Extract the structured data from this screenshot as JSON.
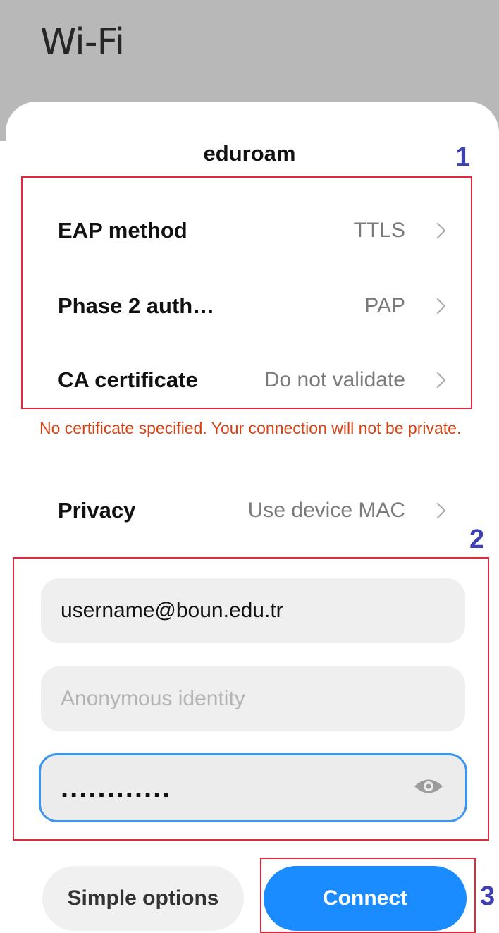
{
  "app": {
    "title": "Wi-Fi"
  },
  "dialog": {
    "network_name": "eduroam",
    "settings": [
      {
        "label": "EAP method",
        "value": "TTLS"
      },
      {
        "label": "Phase 2 auth…",
        "value": "PAP"
      },
      {
        "label": "CA certificate",
        "value": "Do not validate"
      }
    ],
    "warning": "No certificate specified. Your connection will not be private.",
    "privacy": {
      "label": "Privacy",
      "value": "Use device MAC"
    },
    "identity": {
      "value": "username@boun.edu.tr"
    },
    "anonymous_identity": {
      "placeholder": "Anonymous identity"
    },
    "password": {
      "masked_value": "............",
      "icon": "eye-icon"
    },
    "buttons": {
      "simple_options": "Simple options",
      "connect": "Connect"
    }
  },
  "annotations": {
    "box1": "1",
    "box2": "2",
    "box3": "3",
    "color": "#e0293f",
    "number_color": "#3d3fb2"
  }
}
